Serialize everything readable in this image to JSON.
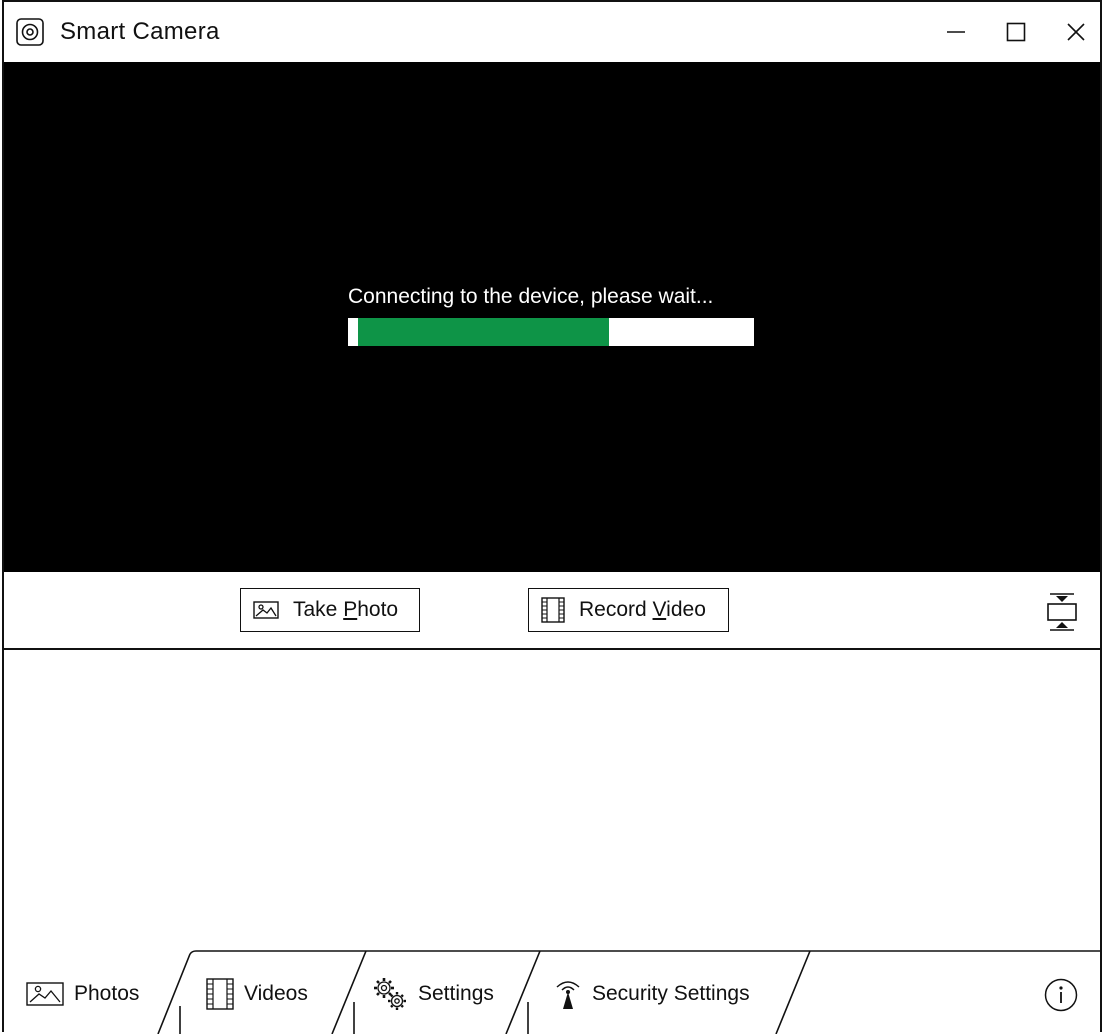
{
  "window": {
    "title": "Smart Camera",
    "icons": {
      "app": "camera-lens-icon",
      "minimize": "minimize-icon",
      "maximize": "maximize-icon",
      "close": "close-icon"
    }
  },
  "viewer": {
    "status_text": "Connecting to the device, please wait...",
    "progress_percent": 65,
    "progress_color": "#0e9447"
  },
  "actions": {
    "take_photo": {
      "prefix": "Take ",
      "mnemonic": "P",
      "suffix": "hoto",
      "icon": "photo-icon"
    },
    "record_video": {
      "prefix": "Record ",
      "mnemonic": "V",
      "suffix": "ideo",
      "icon": "film-icon"
    },
    "fit_icon": "fit-height-icon"
  },
  "tabs": [
    {
      "label": "Photos",
      "icon": "photo-icon",
      "active": true
    },
    {
      "label": "Videos",
      "icon": "film-icon",
      "active": false
    },
    {
      "label": "Settings",
      "icon": "gears-icon",
      "active": false
    },
    {
      "label": "Security Settings",
      "icon": "antenna-icon",
      "active": false
    }
  ],
  "info_icon": "info-icon"
}
